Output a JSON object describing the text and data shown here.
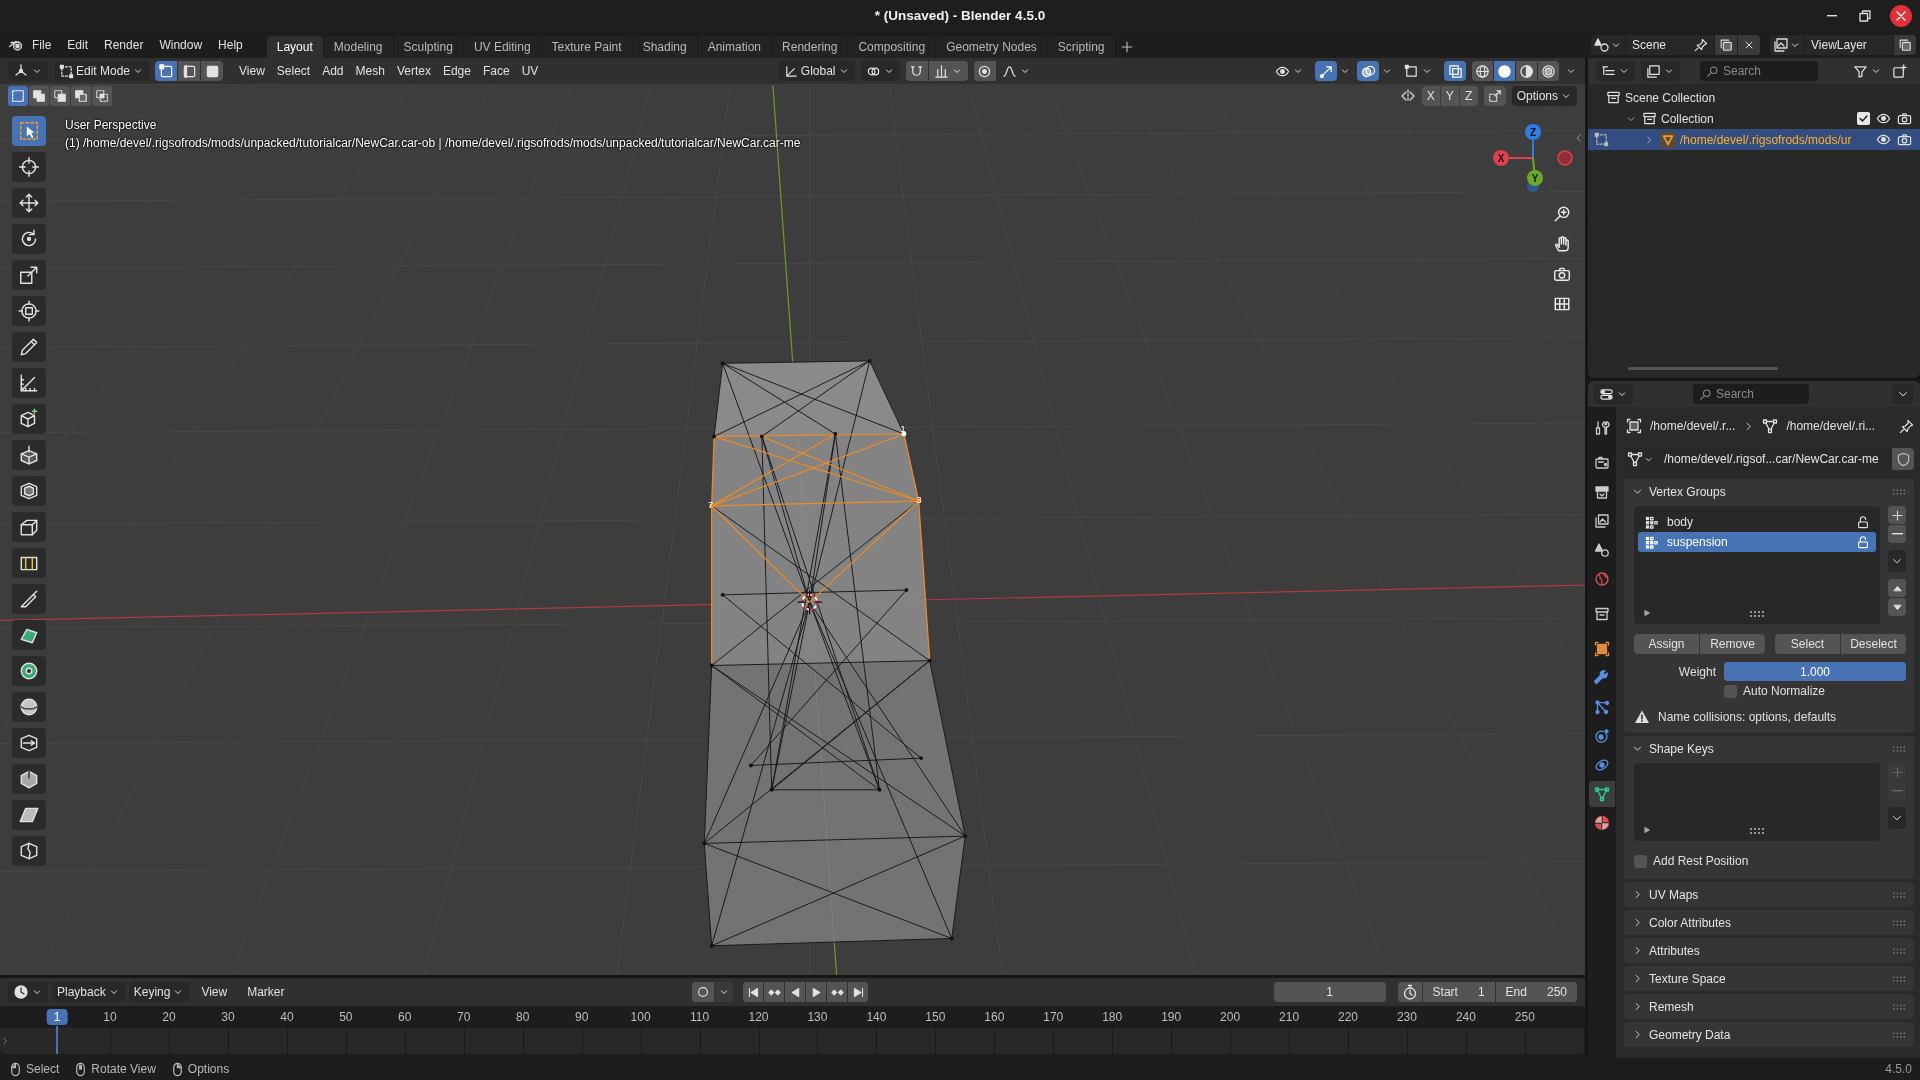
{
  "window": {
    "title": "* (Unsaved) - Blender 4.5.0"
  },
  "menu": [
    "File",
    "Edit",
    "Render",
    "Window",
    "Help"
  ],
  "workspaces": [
    {
      "label": "Layout",
      "selected": true
    },
    {
      "label": "Modeling",
      "selected": false
    },
    {
      "label": "Sculpting",
      "selected": false
    },
    {
      "label": "UV Editing",
      "selected": false
    },
    {
      "label": "Texture Paint",
      "selected": false
    },
    {
      "label": "Shading",
      "selected": false
    },
    {
      "label": "Animation",
      "selected": false
    },
    {
      "label": "Rendering",
      "selected": false
    },
    {
      "label": "Compositing",
      "selected": false
    },
    {
      "label": "Geometry Nodes",
      "selected": false
    },
    {
      "label": "Scripting",
      "selected": false
    }
  ],
  "scene": {
    "label": "Scene"
  },
  "view_layer": {
    "label": "ViewLayer"
  },
  "viewport": {
    "mode": "Edit Mode",
    "select_modes": [
      {
        "kind": "vertex",
        "selected": true
      },
      {
        "kind": "edge",
        "selected": false
      },
      {
        "kind": "face",
        "selected": false
      }
    ],
    "menus": [
      "View",
      "Select",
      "Add",
      "Mesh",
      "Vertex",
      "Edge",
      "Face",
      "UV"
    ],
    "orientation": "Global",
    "toggles": [
      {
        "kind": "gizmos",
        "on": true
      },
      {
        "kind": "overlays",
        "on": true
      },
      {
        "kind": "xray",
        "on": true
      }
    ],
    "shading_modes": [
      {
        "kind": "wireframe",
        "selected": false
      },
      {
        "kind": "solid",
        "selected": true
      },
      {
        "kind": "material",
        "selected": false
      },
      {
        "kind": "rendered",
        "selected": false
      }
    ],
    "box_modes": [
      {
        "kind": "new",
        "selected": true
      },
      {
        "kind": "extend",
        "selected": false
      },
      {
        "kind": "subtract",
        "selected": false
      },
      {
        "kind": "invert",
        "selected": false
      },
      {
        "kind": "intersect",
        "selected": false
      }
    ],
    "mirror_axes": [
      {
        "label": "X",
        "selected": false
      },
      {
        "label": "Y",
        "selected": false
      },
      {
        "label": "Z",
        "selected": false
      }
    ],
    "options": "Options",
    "view_name": "User Perspective",
    "object_info": "(1) /home/devel/.rigsofrods/mods/unpacked/tutorialcar/NewCar.car-ob | /home/devel/.rigsofrods/mods/unpacked/tutorialcar/NewCar.car-me",
    "gizmo": [
      "Z",
      "X",
      "Y"
    ],
    "vertex_labels": [
      "1",
      "3",
      "7"
    ],
    "tools": [
      {
        "kind": "select",
        "selected": true
      },
      {
        "kind": "cursor",
        "selected": false
      },
      {
        "kind": "move",
        "selected": false
      },
      {
        "kind": "rotate",
        "selected": false
      },
      {
        "kind": "scale",
        "selected": false
      },
      {
        "kind": "transform",
        "selected": false
      },
      {
        "kind": "annotate",
        "selected": false
      },
      {
        "kind": "measure",
        "selected": false
      },
      {
        "kind": "add_cube",
        "selected": false
      },
      {
        "kind": "extrude",
        "selected": false
      },
      {
        "kind": "inset",
        "selected": false
      },
      {
        "kind": "bevel",
        "selected": false
      },
      {
        "kind": "loop_cut",
        "selected": false
      },
      {
        "kind": "knife",
        "selected": false
      },
      {
        "kind": "poly_build",
        "selected": false
      },
      {
        "kind": "spin",
        "selected": false
      },
      {
        "kind": "smooth",
        "selected": false
      },
      {
        "kind": "edge_slide",
        "selected": false
      },
      {
        "kind": "shrink",
        "selected": false
      },
      {
        "kind": "shear",
        "selected": false
      },
      {
        "kind": "rip",
        "selected": false
      }
    ]
  },
  "outliner": {
    "search_placeholder": "Search",
    "tree": [
      {
        "label": "Scene Collection",
        "children": [
          {
            "label": "Collection",
            "expanded": true,
            "checked": true,
            "children": [
              {
                "label": "/home/devel/.rigsofrods/mods/ur",
                "expanded": false,
                "selected": true,
                "edit_mode": true
              }
            ]
          }
        ]
      }
    ]
  },
  "properties": {
    "search_placeholder": "Search",
    "tabs": [
      {
        "kind": "tool",
        "selected": false
      },
      {
        "kind": "render",
        "selected": false
      },
      {
        "kind": "output",
        "selected": false
      },
      {
        "kind": "view_layer",
        "selected": false
      },
      {
        "kind": "scene",
        "selected": false
      },
      {
        "kind": "world",
        "selected": false
      },
      {
        "kind": "collection",
        "selected": false
      },
      {
        "kind": "object",
        "selected": false
      },
      {
        "kind": "modifiers",
        "selected": false
      },
      {
        "kind": "particles",
        "selected": false
      },
      {
        "kind": "physics",
        "selected": false
      },
      {
        "kind": "constraints",
        "selected": false
      },
      {
        "kind": "data",
        "selected": true
      },
      {
        "kind": "material",
        "selected": false
      }
    ],
    "breadcrumb": [
      "/home/devel/.r...",
      "/home/devel/.ri..."
    ],
    "mesh_name": "/home/devel/.rigsof...car/NewCar.car-me",
    "panels": [
      {
        "kind": "vertex_groups",
        "title": "Vertex Groups",
        "expanded": true,
        "groups": [
          {
            "name": "body",
            "selected": false
          },
          {
            "name": "suspension",
            "selected": true
          }
        ],
        "buttons": [
          "Assign",
          "Remove",
          "Select",
          "Deselect"
        ],
        "weight": {
          "label": "Weight",
          "reading": "1.000",
          "level": 1
        },
        "auto_normalize": {
          "label": "Auto Normalize",
          "checked": false
        },
        "warning": "Name collisions: options, defaults"
      },
      {
        "kind": "shape_keys",
        "title": "Shape Keys",
        "expanded": true,
        "rest_position": {
          "label": "Add Rest Position",
          "checked": false
        }
      },
      {
        "kind": "plain",
        "title": "UV Maps",
        "expanded": false
      },
      {
        "kind": "plain",
        "title": "Color Attributes",
        "expanded": false
      },
      {
        "kind": "plain",
        "title": "Attributes",
        "expanded": false
      },
      {
        "kind": "plain",
        "title": "Texture Space",
        "expanded": false
      },
      {
        "kind": "plain",
        "title": "Remesh",
        "expanded": false
      },
      {
        "kind": "plain",
        "title": "Geometry Data",
        "expanded": false
      }
    ]
  },
  "timeline": {
    "menus": [
      {
        "label": "Playback",
        "kind": "dropdown"
      },
      {
        "label": "Keying",
        "kind": "dropdown"
      },
      {
        "label": "View",
        "kind": "menu"
      },
      {
        "label": "Marker",
        "kind": "menu"
      }
    ],
    "current_frame": "1",
    "start": {
      "label": "Start",
      "value": "1"
    },
    "end": {
      "label": "End",
      "value": "250"
    },
    "frame_marker": "1",
    "ticks": [
      "10",
      "20",
      "30",
      "40",
      "50",
      "60",
      "70",
      "80",
      "90",
      "100",
      "110",
      "120",
      "130",
      "140",
      "150",
      "160",
      "170",
      "180",
      "190",
      "200",
      "210",
      "220",
      "230",
      "240",
      "250"
    ]
  },
  "status_bar": {
    "hints": [
      {
        "kind": "left",
        "label": "Select"
      },
      {
        "kind": "middle",
        "label": "Rotate View"
      },
      {
        "kind": "right",
        "label": "Options"
      }
    ],
    "version": "4.5.0"
  }
}
